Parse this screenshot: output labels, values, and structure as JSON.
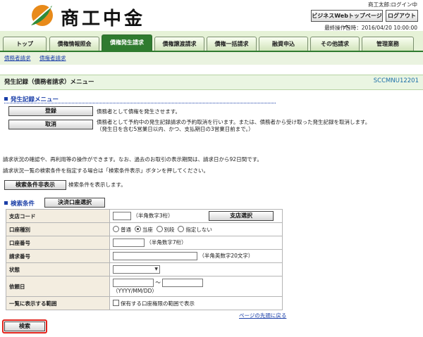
{
  "header": {
    "logo_text": "商工中金",
    "user_name": "商工太郎:ログイン中",
    "biz_top_button": "ビジネスWebトップページへ",
    "logout_button": "ログアウト",
    "last_login": "最終操作日時：2016/04/20 10:00:00"
  },
  "tabs": [
    {
      "label": "トップ",
      "active": false
    },
    {
      "label": "債権情報照会",
      "active": false
    },
    {
      "label": "債権発生請求",
      "active": true
    },
    {
      "label": "債権譲渡請求",
      "active": false
    },
    {
      "label": "債権一括請求",
      "active": false
    },
    {
      "label": "融資申込",
      "active": false
    },
    {
      "label": "その他請求",
      "active": false
    },
    {
      "label": "管理業務",
      "active": false
    }
  ],
  "subnav": [
    "債務者請求",
    "債権者請求"
  ],
  "page": {
    "title": "発生記録（債務者請求）メニュー",
    "screen_id": "SCCMNU12201"
  },
  "menu": {
    "heading": "発生記録メニュー",
    "register_button": "登録",
    "register_desc": "債務者として債権を発生させます。",
    "cancel_button": "取消",
    "cancel_desc_1": "債務者として予約中の発生記録請求の予約取消を行います。または、債務者から受け取った発生記録を取消します。",
    "cancel_desc_2": "（発生日を含む5営業日以内、かつ、支払期日の3営業日前まで。）"
  },
  "info": {
    "line1": "請求状況の確認や、再利用等の操作ができます。なお、過去のお取引の表示期間は、請求日から92日間です。",
    "line2": "請求状況一覧の検索条件を指定する場合は「検索条件表示」ボタンを押してください。",
    "toggle_button": "検索条件非表示",
    "toggle_desc": "検索条件を表示します。"
  },
  "search": {
    "heading": "検索条件",
    "account_select_button": "決済口座選択",
    "branch_code_label": "支店コード",
    "branch_code_hint": "（半角数字3桁）",
    "branch_select_button": "支店選択",
    "account_type_label": "口座種別",
    "account_type_options": [
      "普通",
      "当座",
      "別段",
      "指定しない"
    ],
    "account_type_selected": 1,
    "account_no_label": "口座番号",
    "account_no_hint": "（半角数字7桁）",
    "request_no_label": "請求番号",
    "request_no_hint": "（半角英数字20文字）",
    "status_label": "状態",
    "request_date_label": "依頼日",
    "date_separator": "〜",
    "date_format_hint": "（YYYY/MM/DD）",
    "scope_label": "一覧に表示する範囲",
    "scope_checkbox_label": "保有する口座権限の範囲で表示",
    "back_to_top": "ページの先頭に戻る",
    "search_button": "検索"
  },
  "colors": {
    "accent_green": "#2f7b2f",
    "highlight_red": "#e0221b",
    "link_blue": "#1b3fa8"
  }
}
